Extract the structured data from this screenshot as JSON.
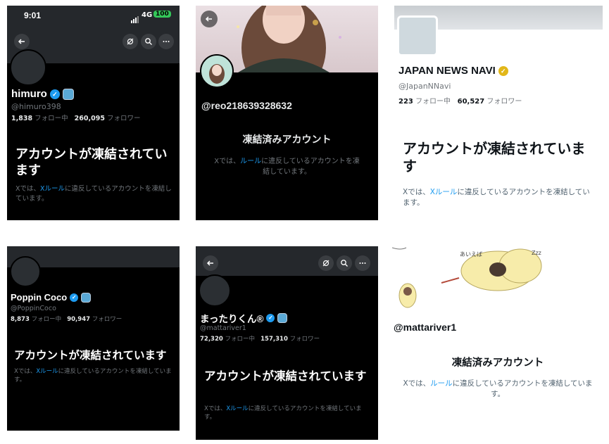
{
  "status_bar": {
    "time": "9:01",
    "network": "4G",
    "battery": "100"
  },
  "panels": {
    "p1": {
      "name": "himuro",
      "handle": "@himuro398",
      "following": "1,838",
      "following_label": "フォロー中",
      "followers": "260,095",
      "followers_label": "フォロワー",
      "title": "アカウントが凍結されています",
      "desc_pre": "Xでは、",
      "desc_link": "Xルール",
      "desc_post": "に違反しているアカウントを凍結しています。"
    },
    "p2": {
      "handle": "@reo218639328632",
      "title": "凍結済みアカウント",
      "desc_pre": "Xでは、",
      "desc_link": "ルール",
      "desc_post": "に違反しているアカウントを凍結しています。"
    },
    "p3": {
      "name": "JAPAN NEWS NAVI",
      "handle": "@JapanNNavi",
      "following": "223",
      "following_label": "フォロー中",
      "followers": "60,527",
      "followers_label": "フォロワー",
      "title": "アカウントが凍結されています",
      "desc_pre": "Xでは、",
      "desc_link": "Xルール",
      "desc_post": "に違反しているアカウントを凍結しています。"
    },
    "p4": {
      "name": "Poppin Coco",
      "handle": "@PoppinCoco",
      "following": "8,873",
      "following_label": "フォロー中",
      "followers": "90,947",
      "followers_label": "フォロワー",
      "title": "アカウントが凍結されています",
      "desc_pre": "Xでは、",
      "desc_link": "Xルール",
      "desc_post": "に違反しているアカウントを凍結しています。"
    },
    "p5": {
      "name": "まったりくん®",
      "handle": "@mattariver1",
      "following": "72,320",
      "following_label": "フォロー中",
      "followers": "157,310",
      "followers_label": "フォロワー",
      "title": "アカウントが凍結されています",
      "desc_pre": "Xでは、",
      "desc_link": "Xルール",
      "desc_post": "に違反しているアカウントを凍結しています。"
    },
    "p6": {
      "handle": "@mattariver1",
      "title": "凍結済みアカウント",
      "desc_pre": "Xでは、",
      "desc_link": "ルール",
      "desc_post": "に違反しているアカウントを凍結しています。",
      "doodle_text_1": "あいえば",
      "doodle_text_2": "Zzz"
    }
  },
  "colors": {
    "link": "#1d9bf0",
    "verified": "#1d9bf0",
    "gold": "#e2b719",
    "dark_bg": "#000000"
  },
  "icons": [
    "back-arrow-icon",
    "mute-icon",
    "search-icon",
    "more-icon",
    "verified-badge-icon",
    "org-badge-icon",
    "signal-icon",
    "battery-icon"
  ]
}
